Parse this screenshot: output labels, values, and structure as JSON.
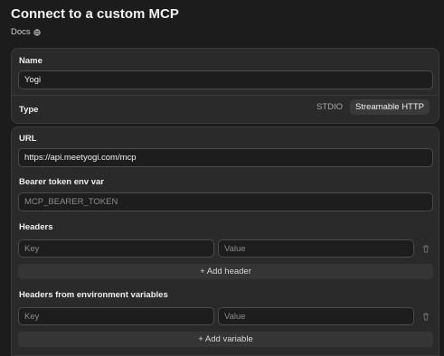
{
  "header": {
    "title": "Connect to a custom MCP",
    "docs_label": "Docs"
  },
  "name_section": {
    "label": "Name",
    "value": "Yogi"
  },
  "type_section": {
    "label": "Type",
    "options": [
      "STDIO",
      "Streamable HTTP"
    ],
    "selected": "Streamable HTTP"
  },
  "url_section": {
    "label": "URL",
    "value": "https://api.meetyogi.com/mcp"
  },
  "bearer_section": {
    "label": "Bearer token env var",
    "placeholder": "MCP_BEARER_TOKEN"
  },
  "headers_section": {
    "label": "Headers",
    "key_placeholder": "Key",
    "value_placeholder": "Value",
    "add_label": "+ Add header"
  },
  "env_headers_section": {
    "label": "Headers from environment variables",
    "key_placeholder": "Key",
    "value_placeholder": "Value",
    "add_label": "+ Add variable"
  }
}
